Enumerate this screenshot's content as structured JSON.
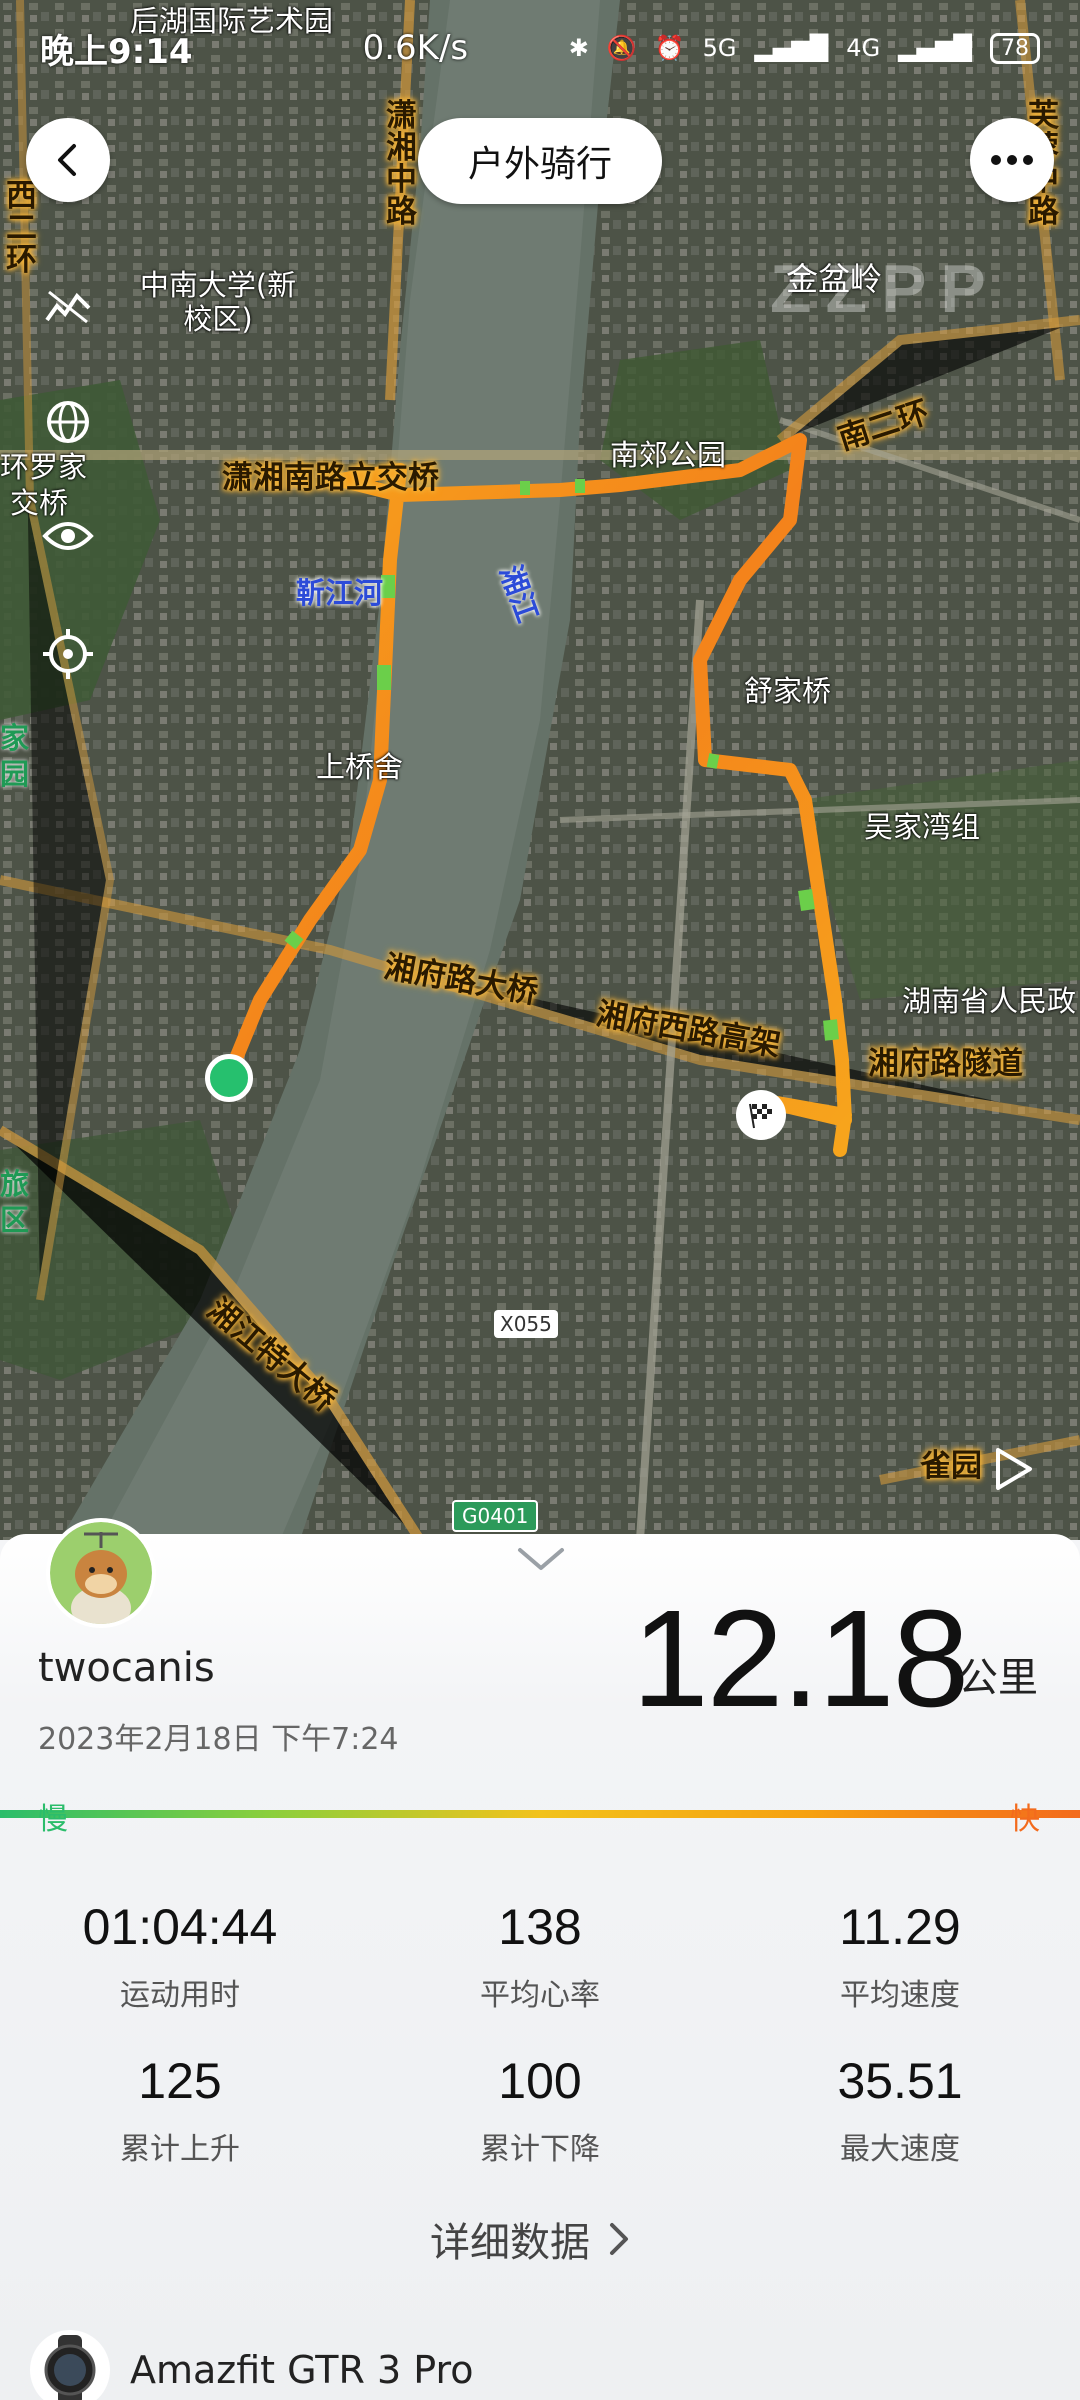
{
  "status_bar": {
    "time": "晚上9:14",
    "net_speed": "0.6K/s",
    "signal_1": "5G",
    "signal_2": "4G",
    "battery": "78"
  },
  "header": {
    "back_icon": "chevron-left-icon",
    "title": "户外骑行",
    "more_icon": "more-dots-icon"
  },
  "side_tools": [
    "satellite-off-icon",
    "globe-icon",
    "eye-icon",
    "locate-icon"
  ],
  "map": {
    "place_labels": [
      "后湖国际艺术园",
      "中南大学(新校区)",
      "金盆岭",
      "南郊公园",
      "舒家桥",
      "上桥舍",
      "吴家湾组",
      "湖南省人民政",
      "雀园",
      "西二环",
      "环罗家",
      "交桥",
      "家园",
      "旅区"
    ],
    "road_labels": [
      "潇湘中路",
      "潇湘南路立交桥",
      "南二环",
      "湘府路大桥",
      "湘府西路高架",
      "湘府路隧道",
      "湘江特大桥",
      "芙蓉中路"
    ],
    "water_labels": [
      "湘江",
      "靳江河"
    ],
    "badges": [
      "X055",
      "G0401"
    ],
    "watermark": "ZZPP"
  },
  "activity": {
    "username": "twocanis",
    "date": "2023年2月18日 下午7:24",
    "distance": "12.18",
    "distance_unit": "公里",
    "slow_label": "慢",
    "fast_label": "快"
  },
  "stats": [
    {
      "value": "01:04:44",
      "label": "运动用时"
    },
    {
      "value": "138",
      "label": "平均心率"
    },
    {
      "value": "11.29",
      "label": "平均速度"
    },
    {
      "value": "125",
      "label": "累计上升"
    },
    {
      "value": "100",
      "label": "累计下降"
    },
    {
      "value": "35.51",
      "label": "最大速度"
    }
  ],
  "detail_link": "详细数据",
  "device": {
    "name": "Amazfit GTR 3 Pro"
  },
  "colors": {
    "route": "#f5a11c",
    "start": "#26c06e",
    "slow": "#2bbd6b",
    "fast": "#f36b1d"
  }
}
